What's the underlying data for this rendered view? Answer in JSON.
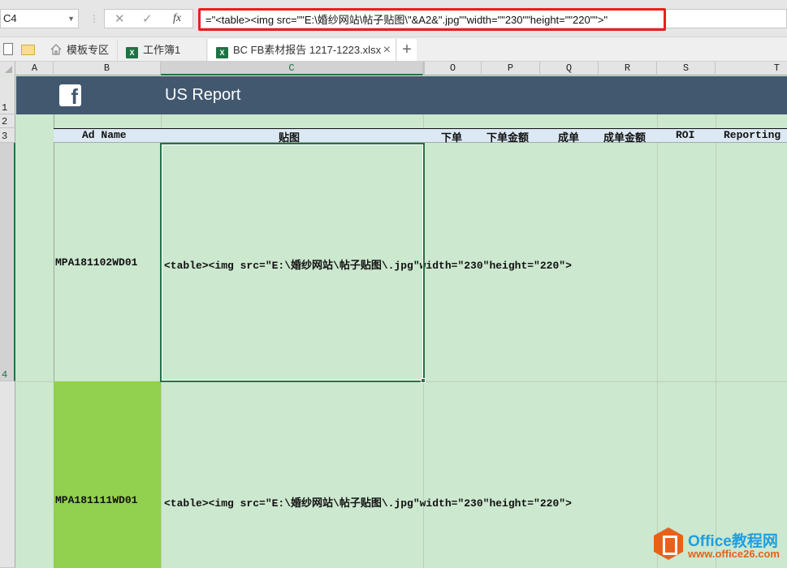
{
  "formula_bar": {
    "name_box": "C4",
    "cancel_icon": "close-icon",
    "enter_icon": "check-icon",
    "fx_label": "fx",
    "formula": "=\"<table><img src=\"\"E:\\婚纱网站\\帖子贴图\\\"&A2&\".jpg\"\"width=\"\"230\"\"height=\"\"220\"\">\""
  },
  "tabs": [
    {
      "label": "模板专区",
      "icon": "home-icon"
    },
    {
      "label": "工作簿1",
      "icon": "excel-icon"
    },
    {
      "label": "BC FB素材报告 1217-1223.xlsx",
      "icon": "excel-icon",
      "active": true
    }
  ],
  "tab_add_label": "+",
  "tab_close_label": "×",
  "columns": [
    "A",
    "B",
    "C",
    "O",
    "P",
    "Q",
    "R",
    "S",
    "T"
  ],
  "selected_column": "C",
  "rows": [
    "1",
    "2",
    "3",
    "4"
  ],
  "selected_row": "4",
  "banner": {
    "logo": "facebook-logo",
    "logo_glyph": "f",
    "title": "US Report",
    "color": "#41586f"
  },
  "header_row": {
    "ad_name": "Ad Name",
    "image": "贴图",
    "orders": "下单",
    "order_amount": "下单金额",
    "deals": "成单",
    "deal_amount": "成单金额",
    "roi": "ROI",
    "reporting": "Reporting"
  },
  "data_rows": [
    {
      "ad_name": "MPA181102WD01",
      "image_html": "<table><img src=\"E:\\婚纱网站\\帖子贴图\\.jpg\"width=\"230\"height=\"220\">"
    },
    {
      "ad_name": "MPA181111WD01",
      "image_html": "<table><img src=\"E:\\婚纱网站\\帖子贴图\\.jpg\"width=\"230\"height=\"220\">",
      "highlight": "#92d050"
    }
  ],
  "watermark": {
    "title": "Office教程网",
    "url": "www.office26.com"
  },
  "colors": {
    "sheet_bg": "#cce8cf",
    "header_bg": "#dce9f4",
    "selection": "#217346",
    "highlight_border": "#e8201f"
  }
}
